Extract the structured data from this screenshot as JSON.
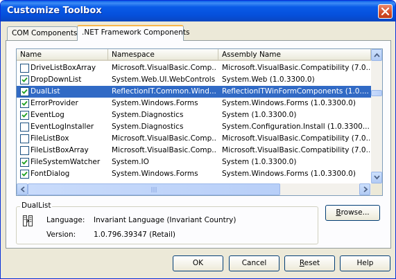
{
  "window": {
    "title": "Customize Toolbox"
  },
  "tabs": [
    {
      "label": "COM Components",
      "active": false
    },
    {
      "label": ".NET Framework Components",
      "active": true
    }
  ],
  "list": {
    "columns": [
      "Name",
      "Namespace",
      "Assembly Name"
    ],
    "rows": [
      {
        "name": "DriveListBoxArray",
        "namespace": "Microsoft.VisualBasic.Comp...",
        "assembly": "Microsoft.VisualBasic.Compatibility (7.0....",
        "checked": false,
        "selected": false
      },
      {
        "name": "DropDownList",
        "namespace": "System.Web.UI.WebControls",
        "assembly": "System.Web (1.0.3300.0)",
        "checked": true,
        "selected": false
      },
      {
        "name": "DualList",
        "namespace": "ReflectionIT.Common.Wind...",
        "assembly": "ReflectionITWinFormComponents (1.0....",
        "checked": true,
        "selected": true
      },
      {
        "name": "ErrorProvider",
        "namespace": "System.Windows.Forms",
        "assembly": "System.Windows.Forms (1.0.3300.0)",
        "checked": true,
        "selected": false
      },
      {
        "name": "EventLog",
        "namespace": "System.Diagnostics",
        "assembly": "System (1.0.3300.0)",
        "checked": true,
        "selected": false
      },
      {
        "name": "EventLogInstaller",
        "namespace": "System.Diagnostics",
        "assembly": "System.Configuration.Install (1.0.3300...",
        "checked": false,
        "selected": false
      },
      {
        "name": "FileListBox",
        "namespace": "Microsoft.VisualBasic.Comp...",
        "assembly": "Microsoft.VisualBasic.Compatibility (7.0....",
        "checked": false,
        "selected": false
      },
      {
        "name": "FileListBoxArray",
        "namespace": "Microsoft.VisualBasic.Comp...",
        "assembly": "Microsoft.VisualBasic.Compatibility (7.0....",
        "checked": false,
        "selected": false
      },
      {
        "name": "FileSystemWatcher",
        "namespace": "System.IO",
        "assembly": "System (1.0.3300.0)",
        "checked": true,
        "selected": false
      },
      {
        "name": "FontDialog",
        "namespace": "System.Windows.Forms",
        "assembly": "System.Windows.Forms (1.0.3300.0)",
        "checked": true,
        "selected": false
      }
    ]
  },
  "details": {
    "group_title": "DualList",
    "language_label": "Language:",
    "language_value": "Invariant Language (Invariant Country)",
    "version_label": "Version:",
    "version_value": "1.0.796.39347 (Retail)"
  },
  "buttons": {
    "browse": {
      "pre": "",
      "mnemonic": "B",
      "post": "rowse..."
    },
    "ok": "OK",
    "cancel": "Cancel",
    "reset": {
      "pre": "",
      "mnemonic": "R",
      "post": "eset"
    },
    "help": "Help"
  },
  "colors": {
    "selection": "#316ac5",
    "title_bar": "#0a5ce8",
    "dialog_face": "#ece9d8"
  }
}
